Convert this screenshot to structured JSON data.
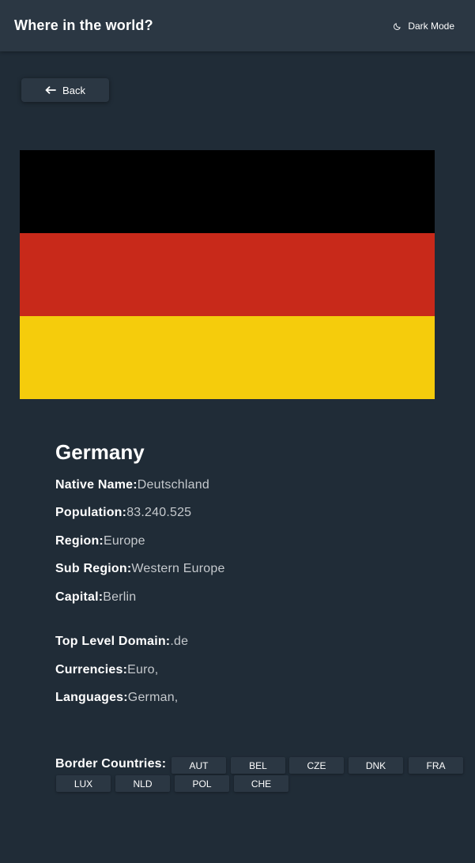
{
  "header": {
    "title": "Where in the world?",
    "mode_label": "Dark Mode",
    "mode_icon": "moon-icon"
  },
  "back_button": {
    "label": "Back",
    "icon": "arrow-left-icon"
  },
  "flag": {
    "colors": [
      "#000000",
      "#c8291a",
      "#f5cc0c"
    ]
  },
  "country": {
    "name": "Germany",
    "native_name_label": "Native Name:",
    "native_name": "Deutschland",
    "population_label": "Population:",
    "population": "83.240.525",
    "region_label": "Region:",
    "region": "Europe",
    "subregion_label": "Sub Region:",
    "subregion": "Western Europe",
    "capital_label": "Capital:",
    "capital": "Berlin",
    "tld_label": "Top Level Domain:",
    "tld": ".de",
    "currencies_label": "Currencies:",
    "currencies": "Euro,",
    "languages_label": "Languages:",
    "languages": "German,"
  },
  "borders": {
    "label": "Border Countries:",
    "items": [
      "AUT",
      "BEL",
      "CZE",
      "DNK",
      "FRA",
      "LUX",
      "NLD",
      "POL",
      "CHE"
    ]
  },
  "colors": {
    "background": "#202c37",
    "element": "#2b3743",
    "text": "#ffffff",
    "muted_text": "#c5c9cd"
  }
}
